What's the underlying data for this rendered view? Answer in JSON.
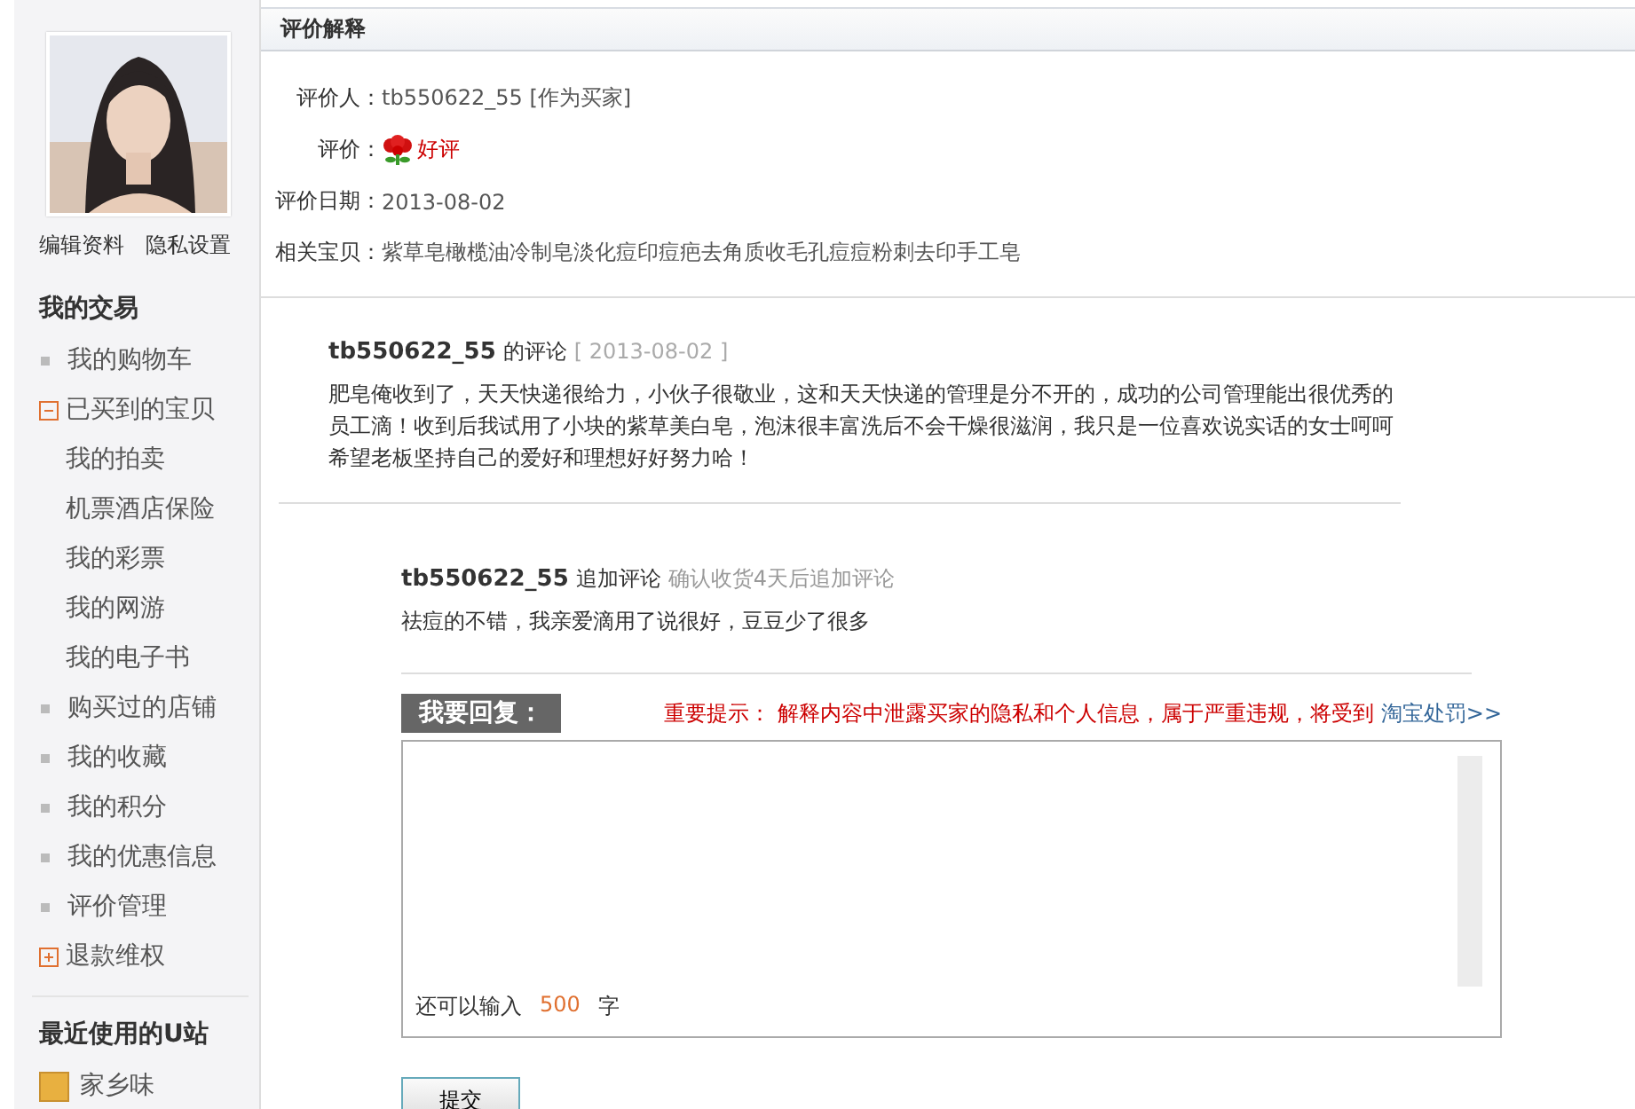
{
  "sidebar": {
    "profile_links": [
      "编辑资料",
      "隐私设置"
    ],
    "sections": [
      {
        "title": "我的交易",
        "items": [
          {
            "label": "我的购物车",
            "kind": "link"
          },
          {
            "label": "已买到的宝贝",
            "kind": "group",
            "expanded": true,
            "children": [
              {
                "label": "我的拍卖"
              },
              {
                "label": "机票酒店保险"
              },
              {
                "label": "我的彩票"
              },
              {
                "label": "我的网游"
              },
              {
                "label": "我的电子书"
              }
            ]
          },
          {
            "label": "购买过的店铺",
            "kind": "link"
          },
          {
            "label": "我的收藏",
            "kind": "link"
          },
          {
            "label": "我的积分",
            "kind": "link"
          },
          {
            "label": "我的优惠信息",
            "kind": "link"
          },
          {
            "label": "评价管理",
            "kind": "link"
          },
          {
            "label": "退款维权",
            "kind": "group",
            "expanded": false
          }
        ]
      },
      {
        "title": "最近使用的U站",
        "items": [
          {
            "label": "家乡味",
            "kind": "site"
          }
        ]
      }
    ]
  },
  "panel_title": "评价解释",
  "info": [
    {
      "label": "评价人：",
      "value": "tb550622_55 [作为买家]",
      "kind": "text"
    },
    {
      "label": "评价：",
      "value": "好评",
      "kind": "rating"
    },
    {
      "label": "评价日期：",
      "value": "2013-08-02",
      "kind": "text"
    },
    {
      "label": "相关宝贝：",
      "value": "紫草皂橄榄油冷制皂淡化痘印痘疤去角质收毛孔痘痘粉刺去印手工皂",
      "kind": "text"
    }
  ],
  "comment": {
    "user": "tb550622_55",
    "action": "的评论",
    "date": "[ 2013-08-02 ]",
    "text": "肥皂俺收到了，天天快递很给力，小伙子很敬业，这和天天快递的管理是分不开的，成功的公司管理能出很优秀的员工滴！收到后我试用了小块的紫草美白皂，泡沫很丰富洗后不会干燥很滋润，我只是一位喜欢说实话的女士呵呵希望老板坚持自己的爱好和理想好好努力哈！"
  },
  "append": {
    "user": "tb550622_55",
    "action": "追加评论",
    "note": "确认收货4天后追加评论",
    "text": "祛痘的不错，我亲爱滴用了说很好，豆豆少了很多"
  },
  "reply": {
    "heading": "我要回复：",
    "warning_label": "重要提示：",
    "warning": "解释内容中泄露买家的隐私和个人信息，属于严重违规，将受到",
    "link": "淘宝处罚>>",
    "counter_prefix": "还可以输入",
    "counter": "500",
    "counter_suffix": "字",
    "submit": "提交"
  }
}
